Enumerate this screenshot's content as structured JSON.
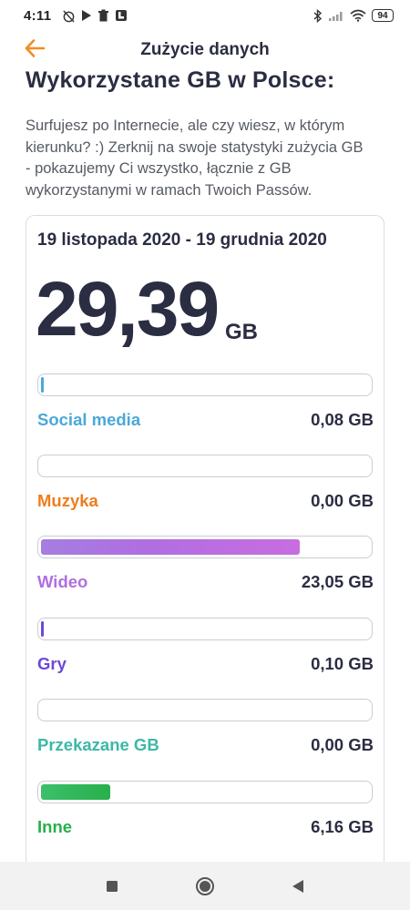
{
  "status_bar": {
    "time": "4:11",
    "battery": "94",
    "left_icons": [
      "alarm-off-icon",
      "play-icon",
      "trash-icon",
      "app-notification-icon"
    ],
    "right_icons": [
      "bluetooth-icon",
      "signal-icon",
      "wifi-icon",
      "battery-icon"
    ]
  },
  "header": {
    "title": "Zużycie danych",
    "back_icon": "arrow-left-icon",
    "accent_color": "#f28c1b"
  },
  "section": {
    "title": "Wykorzystane GB w Polsce:",
    "intro": "Surfujesz po Internecie, ale czy wiesz, w którym kierunku? :) Zerknij na swoje statystyki zużycia GB - pokazujemy Ci wszystko, łącznie z GB wykorzystanymi w ramach Twoich Passów."
  },
  "usage": {
    "period": "19 listopada 2020 - 19 grudnia 2020",
    "total_value": "29,39",
    "total_unit": "GB",
    "categories": [
      {
        "label": "Social media",
        "value": "0,08 GB",
        "fill_fraction": 0.003,
        "color": "#4aa8d8"
      },
      {
        "label": "Muzyka",
        "value": "0,00 GB",
        "fill_fraction": 0.0,
        "color": "#ee7d1e"
      },
      {
        "label": "Wideo",
        "value": "23,05 GB",
        "fill_fraction": 0.79,
        "color": "#b06ee0"
      },
      {
        "label": "Gry",
        "value": "0,10 GB",
        "fill_fraction": 0.004,
        "color": "#6c49d6"
      },
      {
        "label": "Przekazane GB",
        "value": "0,00 GB",
        "fill_fraction": 0.0,
        "color": "#3db8a6"
      },
      {
        "label": "Inne",
        "value": "6,16 GB",
        "fill_fraction": 0.21,
        "color": "#27b04b"
      }
    ]
  },
  "navigation": {
    "buttons": [
      "recents-square-icon",
      "home-circle-icon",
      "back-triangle-icon"
    ]
  }
}
